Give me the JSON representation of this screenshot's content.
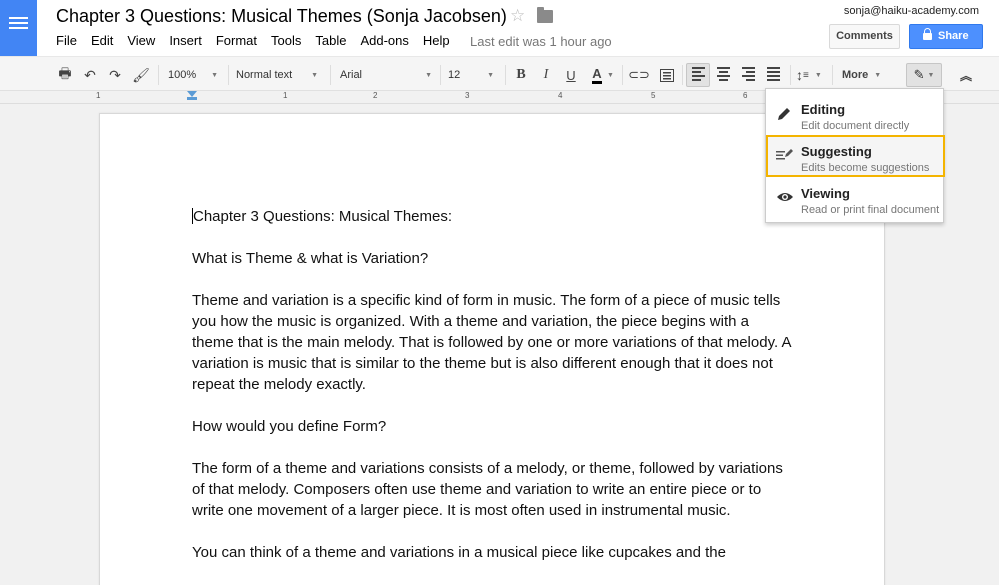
{
  "header": {
    "doc_title": "Chapter 3 Questions: Musical Themes (Sonja Jacobsen)",
    "user_email": "sonja@haiku-academy.com",
    "comments_label": "Comments",
    "share_label": "Share",
    "last_edit": "Last edit was 1 hour ago",
    "accent_color": "#4285f4"
  },
  "menu": {
    "items": [
      "File",
      "Edit",
      "View",
      "Insert",
      "Format",
      "Tools",
      "Table",
      "Add-ons",
      "Help"
    ]
  },
  "toolbar": {
    "zoom": "100%",
    "style": "Normal text",
    "font": "Arial",
    "font_size": "12",
    "more_label": "More",
    "bold": "B",
    "italic": "I",
    "underline": "U",
    "text_color": "A"
  },
  "ruler": {
    "numbers": [
      "1",
      "1",
      "2",
      "3",
      "4",
      "5",
      "6"
    ]
  },
  "document": {
    "paragraphs": [
      "Chapter 3 Questions: Musical Themes:",
      "What is Theme & what is Variation?",
      "Theme and variation is a specific kind of form in music. The form of a piece of music tells you how the music is organized. With a theme and variation, the piece begins with a theme that is the main melody. That is followed by one or more variations of that melody. A variation is music that is similar to the theme but is also different enough that it does not repeat the melody exactly.",
      "How would you define Form?",
      "The form of a theme and variations consists of a melody, or theme, followed by variations of that melody. Composers often use theme and variation to write an entire piece or to write one movement of a larger piece. It is most often used in instrumental music.",
      "You can think of a theme and variations in a musical piece like cupcakes and the"
    ]
  },
  "mode_menu": {
    "options": [
      {
        "title": "Editing",
        "desc": "Edit document directly",
        "icon": "pencil-icon"
      },
      {
        "title": "Suggesting",
        "desc": "Edits become suggestions",
        "icon": "suggest-icon",
        "selected": true
      },
      {
        "title": "Viewing",
        "desc": "Read or print final document",
        "icon": "eye-icon"
      }
    ],
    "highlight_color": "#f4b400"
  }
}
